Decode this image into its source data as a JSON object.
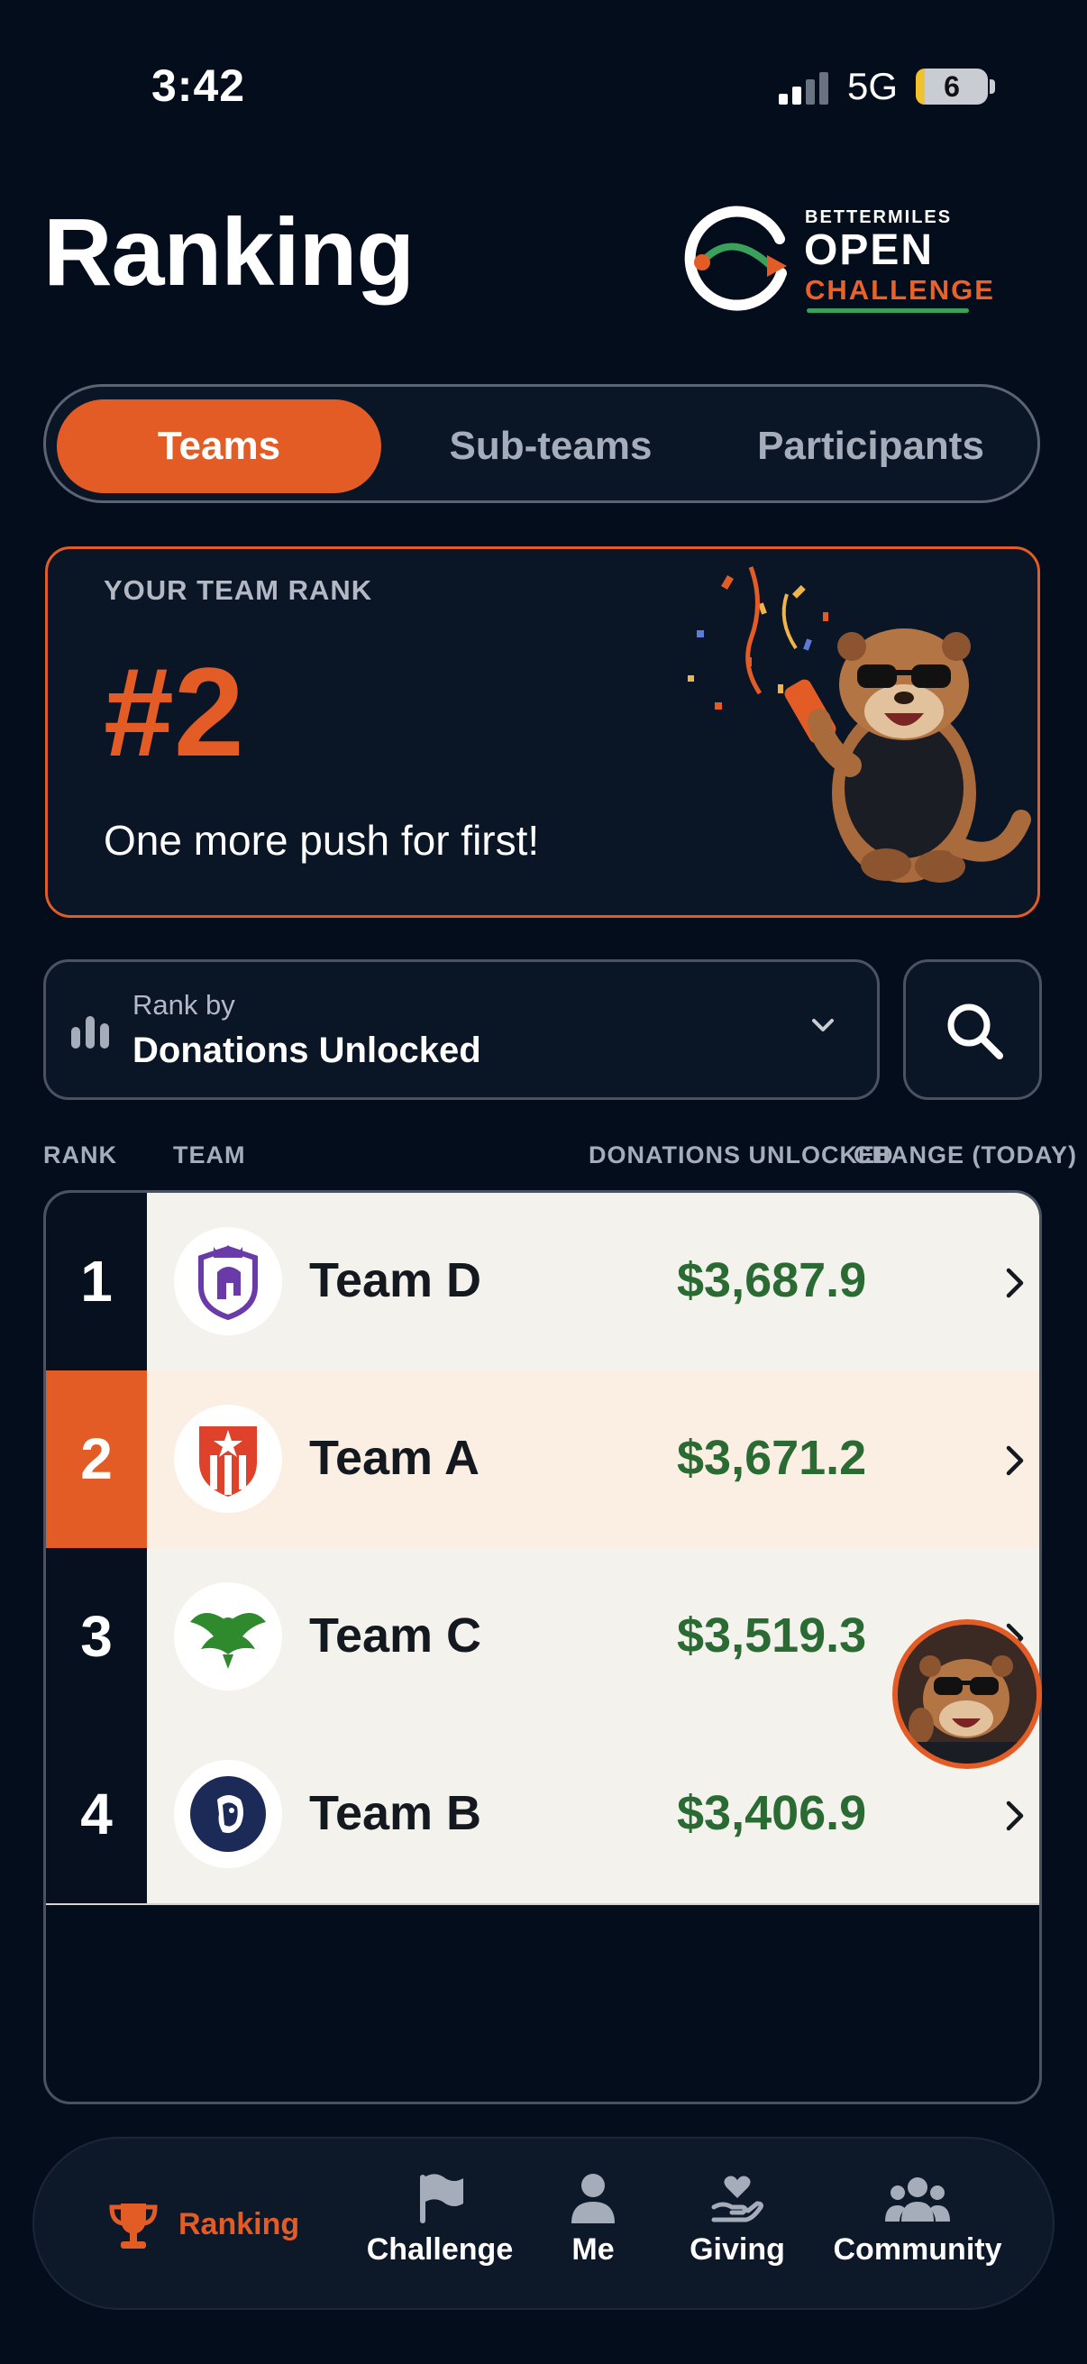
{
  "status_bar": {
    "time": "3:42",
    "network": "5G",
    "battery": "6"
  },
  "header": {
    "title": "Ranking",
    "logo": {
      "small": "BETTERMILES",
      "open": "OPEN",
      "challenge": "CHALLENGE"
    }
  },
  "tabs": [
    {
      "label": "Teams",
      "selected": true
    },
    {
      "label": "Sub-teams",
      "selected": false
    },
    {
      "label": "Participants",
      "selected": false
    }
  ],
  "rank_card": {
    "label": "YOUR TEAM RANK",
    "rank": "#2",
    "message": "One more push for first!"
  },
  "rank_by": {
    "label": "Rank by",
    "value": "Donations Unlocked"
  },
  "columns": {
    "rank": "RANK",
    "team": "TEAM",
    "donations": "DONATIONS UNLOCKED",
    "change": "CHANGE (TODAY)"
  },
  "rows": [
    {
      "rank": "1",
      "team": "Team D",
      "amount": "$3,687.9",
      "highlight": false,
      "badge": "spartan-helmet-shield-icon"
    },
    {
      "rank": "2",
      "team": "Team A",
      "amount": "$3,671.2",
      "highlight": true,
      "badge": "star-stripes-shield-icon"
    },
    {
      "rank": "3",
      "team": "Team C",
      "amount": "$3,519.3",
      "highlight": false,
      "badge": "eagle-icon"
    },
    {
      "rank": "4",
      "team": "Team B",
      "amount": "$3,406.9",
      "highlight": false,
      "badge": "lion-head-icon"
    }
  ],
  "nav": [
    {
      "label": "Ranking",
      "icon": "trophy-icon",
      "active": true
    },
    {
      "label": "Challenge",
      "icon": "flag-icon",
      "active": false
    },
    {
      "label": "Me",
      "icon": "person-icon",
      "active": false
    },
    {
      "label": "Giving",
      "icon": "heart-hand-icon",
      "active": false
    },
    {
      "label": "Community",
      "icon": "people-group-icon",
      "active": false
    }
  ],
  "colors": {
    "accent": "#e35c26",
    "background": "#040d1c",
    "money": "#2a6b33"
  }
}
